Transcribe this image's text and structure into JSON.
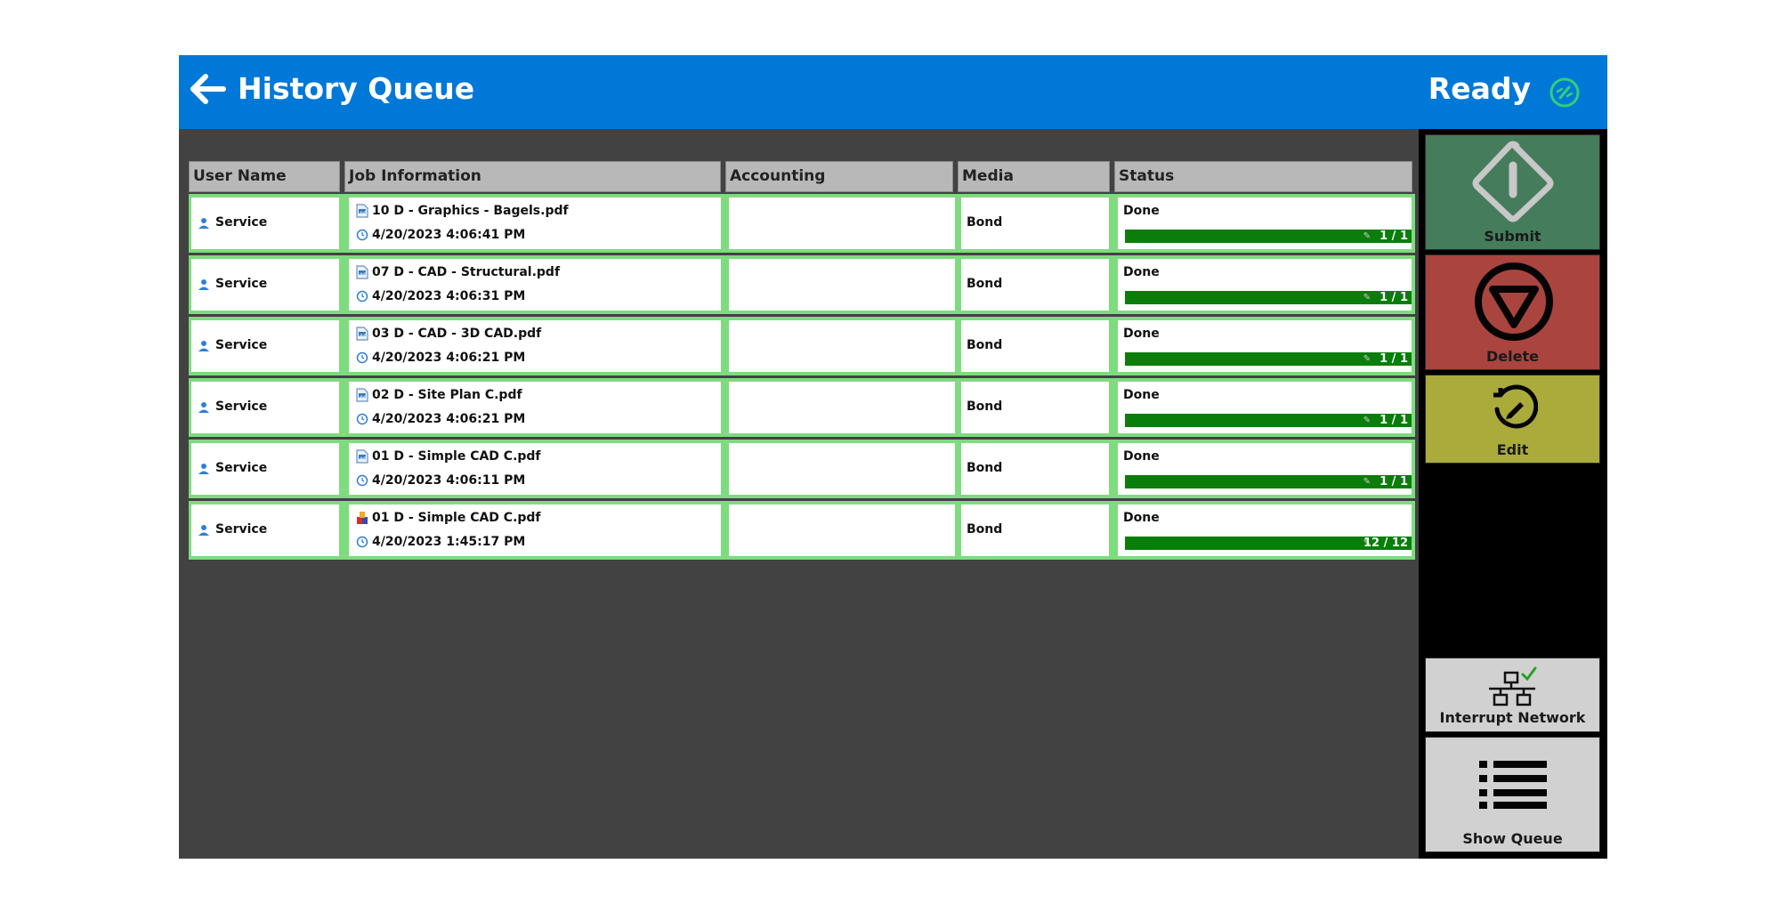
{
  "header": {
    "title": "History Queue",
    "status": "Ready",
    "back_icon": "arrow-left-icon",
    "status_icon": "ready-status-icon"
  },
  "table": {
    "columns": [
      "User Name",
      "Job Information",
      "Accounting",
      "Media",
      "Status"
    ],
    "rows": [
      {
        "user": "Service",
        "file": "10 D - Graphics - Bagels.pdf",
        "time": "4/20/2023 4:06:41 PM",
        "accounting": "",
        "media": "Bond",
        "status": "Done",
        "progress": "1 / 1",
        "progress_fraction": 1.0,
        "file_icon": "document-image-icon"
      },
      {
        "user": "Service",
        "file": "07 D - CAD - Structural.pdf",
        "time": "4/20/2023 4:06:31 PM",
        "accounting": "",
        "media": "Bond",
        "status": "Done",
        "progress": "1 / 1",
        "progress_fraction": 1.0,
        "file_icon": "document-image-icon"
      },
      {
        "user": "Service",
        "file": "03 D - CAD - 3D CAD.pdf",
        "time": "4/20/2023 4:06:21 PM",
        "accounting": "",
        "media": "Bond",
        "status": "Done",
        "progress": "1 / 1",
        "progress_fraction": 1.0,
        "file_icon": "document-image-icon"
      },
      {
        "user": "Service",
        "file": "02 D - Site Plan C.pdf",
        "time": "4/20/2023 4:06:21 PM",
        "accounting": "",
        "media": "Bond",
        "status": "Done",
        "progress": "1 / 1",
        "progress_fraction": 1.0,
        "file_icon": "document-image-icon"
      },
      {
        "user": "Service",
        "file": "01 D - Simple CAD C.pdf",
        "time": "4/20/2023 4:06:11 PM",
        "accounting": "",
        "media": "Bond",
        "status": "Done",
        "progress": "1 / 1",
        "progress_fraction": 1.0,
        "file_icon": "document-image-icon"
      },
      {
        "user": "Service",
        "file": "01 D - Simple CAD C.pdf",
        "time": "4/20/2023 1:45:17 PM",
        "accounting": "",
        "media": "Bond",
        "status": "Done",
        "progress": "12 / 12",
        "progress_fraction": 1.0,
        "file_icon": "multi-color-document-icon"
      }
    ]
  },
  "sidebar": {
    "submit": {
      "label": "Submit",
      "icon": "submit-diamond-icon",
      "color": "#457d5c"
    },
    "delete": {
      "label": "Delete",
      "icon": "stop-triangle-icon",
      "color": "#a9443f"
    },
    "edit": {
      "label": "Edit",
      "icon": "edit-pencil-icon",
      "color": "#abab3b"
    },
    "interrupt": {
      "label": "Interrupt Network",
      "icon": "network-check-icon",
      "color": "#d1d1d1"
    },
    "queue": {
      "label": "Show Queue",
      "icon": "list-icon",
      "color": "#d1d1d1"
    }
  },
  "colors": {
    "title_bar": "#0078d7",
    "background": "#424242",
    "row_border": "#7ddc7d",
    "progress": "#138a13",
    "sidebar": "#000000"
  }
}
